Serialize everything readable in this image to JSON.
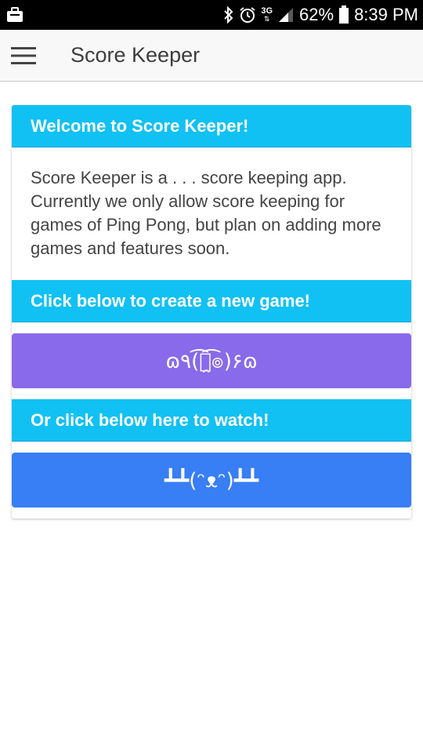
{
  "status_bar": {
    "battery": "62%",
    "time": "8:39 PM",
    "network": "3G",
    "icons": [
      "bag-icon",
      "bluetooth-icon",
      "alarm-icon",
      "signal-icon",
      "battery-icon"
    ]
  },
  "app_bar": {
    "title": "Score Keeper",
    "menu_icon": "hamburger-menu-icon"
  },
  "card": {
    "welcome_header": "Welcome to Score Keeper!",
    "description": "Score Keeper is a . . . score keeping app. Currently we only allow score keeping for games of Ping Pong, but plan on adding more games and features soon.",
    "create_header": "Click below to create a new game!",
    "create_button_label": "ɷ٩(͡๏̯͡๏)۶ɷ",
    "watch_header": "Or click below here to watch!",
    "watch_button_label": "┻┻(ᵔᴥᵔ)┻┻"
  },
  "colors": {
    "header": "#11c1f3",
    "create_button": "#886aea",
    "watch_button": "#387ef5"
  }
}
